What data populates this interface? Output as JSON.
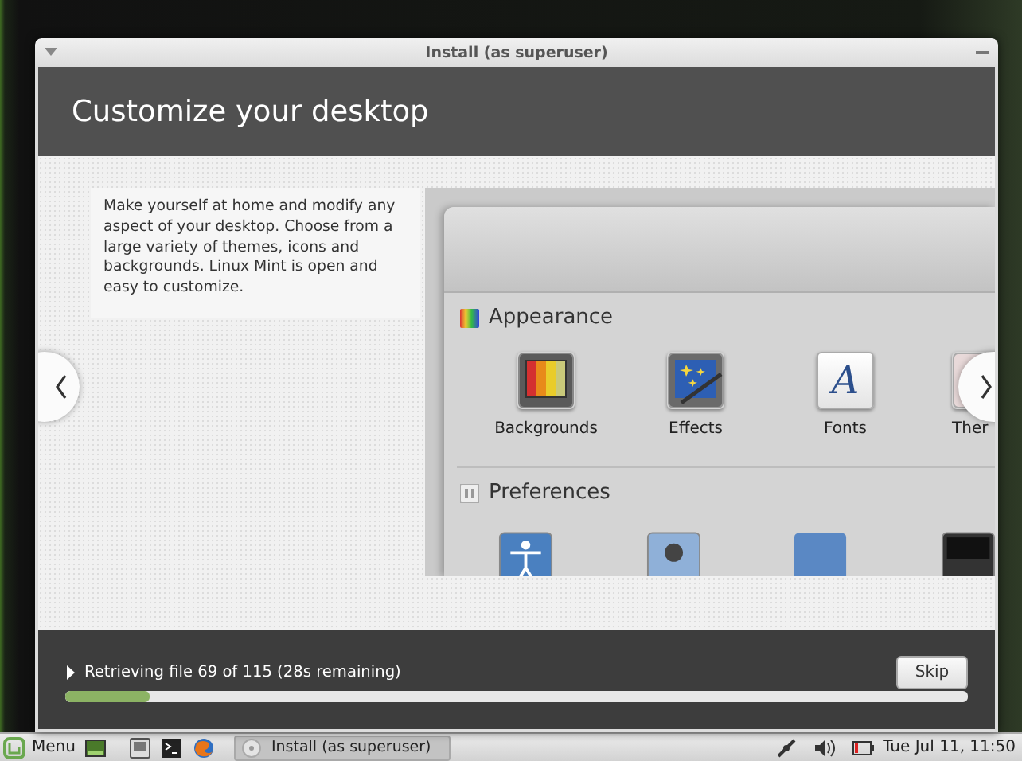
{
  "window": {
    "title": "Install (as superuser)"
  },
  "header": {
    "title": "Customize your desktop"
  },
  "slide": {
    "description": "Make yourself at home and modify any aspect of your desktop. Choose from a large variety of themes, icons and backgrounds. Linux Mint is open and easy to customize.",
    "screenshot": {
      "sections": [
        {
          "title": "Appearance",
          "kind": "appearance",
          "items": [
            {
              "label": "Backgrounds",
              "kind": "backgrounds"
            },
            {
              "label": "Effects",
              "kind": "effects"
            },
            {
              "label": "Fonts",
              "kind": "fonts",
              "glyph": "A"
            },
            {
              "label": "Ther",
              "kind": "themes"
            }
          ]
        },
        {
          "title": "Preferences",
          "kind": "preferences"
        }
      ]
    }
  },
  "progress": {
    "details_expanded": false,
    "status": "Retrieving file 69 of 115 (28s remaining)",
    "level": 0.093
  },
  "skip_button": {
    "label": "Skip"
  },
  "taskbar": {
    "menu": {
      "label": "Menu"
    },
    "windows": [
      {
        "label": "Install (as superuser)",
        "selected": true
      }
    ],
    "clock": "Tue Jul 11, 11:50"
  }
}
